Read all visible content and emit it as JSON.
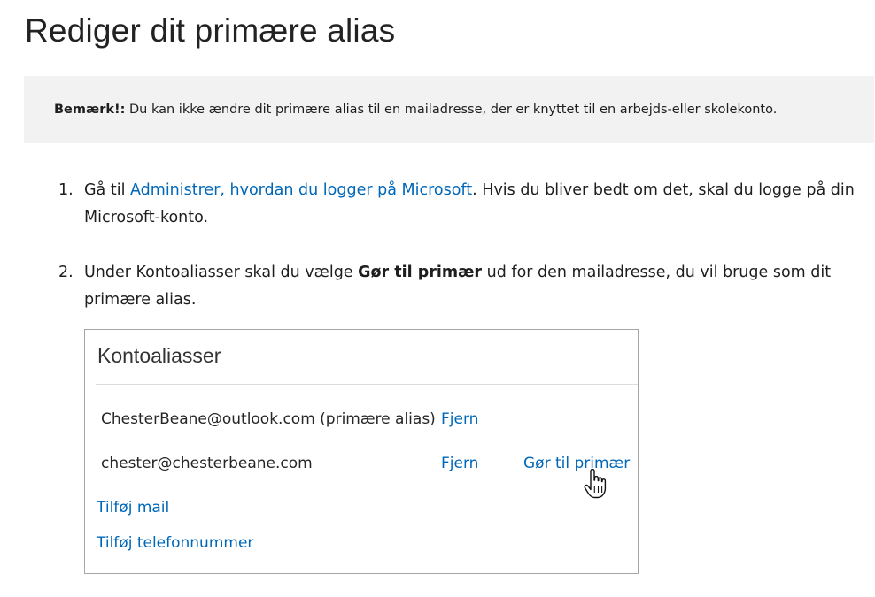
{
  "page": {
    "title": "Rediger dit primære alias"
  },
  "note": {
    "label": "Bemærk!:",
    "text": " Du kan ikke ændre dit primære alias til en mailadresse, der er knyttet til en arbejds-eller skolekonto."
  },
  "steps": [
    {
      "number": "1.",
      "before": "Gå til ",
      "link": "Administrer, hvordan du logger på Microsoft",
      "after": ". Hvis du bliver bedt om det, skal du logge på din Microsoft-konto."
    },
    {
      "number": "2.",
      "before": "Under Kontoaliasser skal du vælge ",
      "bold": "Gør til primær",
      "after": " ud for den mailadresse, du vil bruge som dit primære alias."
    }
  ],
  "panel": {
    "title": "Kontoaliasser",
    "aliases": [
      {
        "email": "ChesterBeane@outlook.com (primære alias)",
        "remove": "Fjern"
      },
      {
        "email": "chester@chesterbeane.com",
        "remove": "Fjern",
        "make_primary": "Gør til primær"
      }
    ],
    "add_mail": "Tilføj mail",
    "add_phone": "Tilføj telefonnummer"
  },
  "icons": {
    "cursor": "hand-pointer-icon"
  },
  "colors": {
    "link": "#0067b8",
    "note_background": "#f2f2f2"
  }
}
